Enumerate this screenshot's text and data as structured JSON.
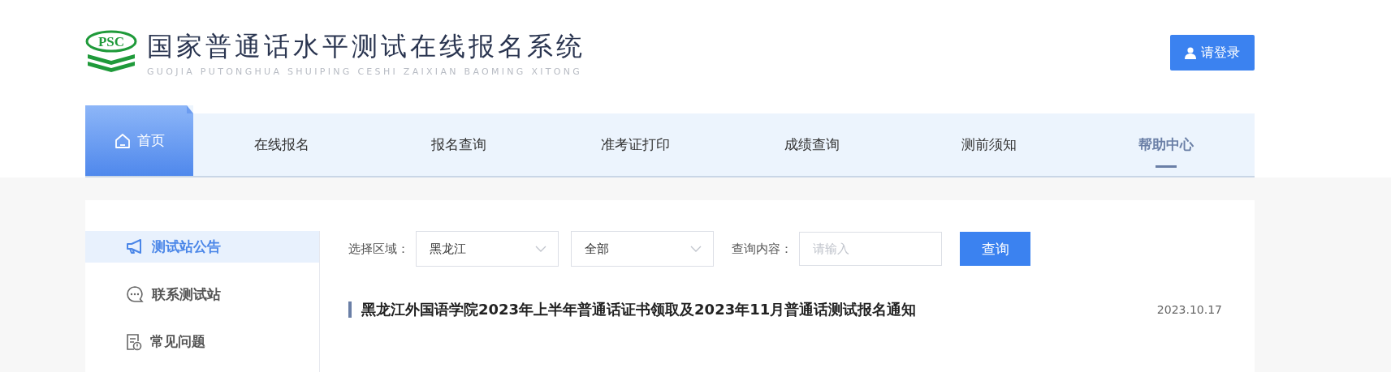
{
  "header": {
    "logo_text": "PSC",
    "title": "国家普通话水平测试在线报名系统",
    "subtitle": "GUOJIA PUTONGHUA SHUIPING CESHI ZAIXIAN BAOMING XITONG",
    "login_button": "请登录"
  },
  "nav": [
    {
      "label": "首页",
      "selected": true,
      "highlighted": false
    },
    {
      "label": "在线报名",
      "selected": false,
      "highlighted": false
    },
    {
      "label": "报名查询",
      "selected": false,
      "highlighted": false
    },
    {
      "label": "准考证打印",
      "selected": false,
      "highlighted": false
    },
    {
      "label": "成绩查询",
      "selected": false,
      "highlighted": false
    },
    {
      "label": "测前须知",
      "selected": false,
      "highlighted": false
    },
    {
      "label": "帮助中心",
      "selected": false,
      "highlighted": true
    }
  ],
  "sidebar": {
    "items": [
      {
        "label": "测试站公告",
        "kind": "megaphone",
        "selected": true
      },
      {
        "label": "联系测试站",
        "kind": "chat",
        "selected": false
      },
      {
        "label": "常见问题",
        "kind": "document",
        "selected": false
      }
    ]
  },
  "filters": {
    "region_label": "选择区域：",
    "region_value": "黑龙江",
    "category_value": "全部",
    "query_label": "查询内容：",
    "query_placeholder": "请输入",
    "search_button": "查询"
  },
  "notices": [
    {
      "title": "黑龙江外国语学院2023年上半年普通话证书领取及2023年11月普通话测试报名通知",
      "date": "2023.10.17"
    }
  ]
}
